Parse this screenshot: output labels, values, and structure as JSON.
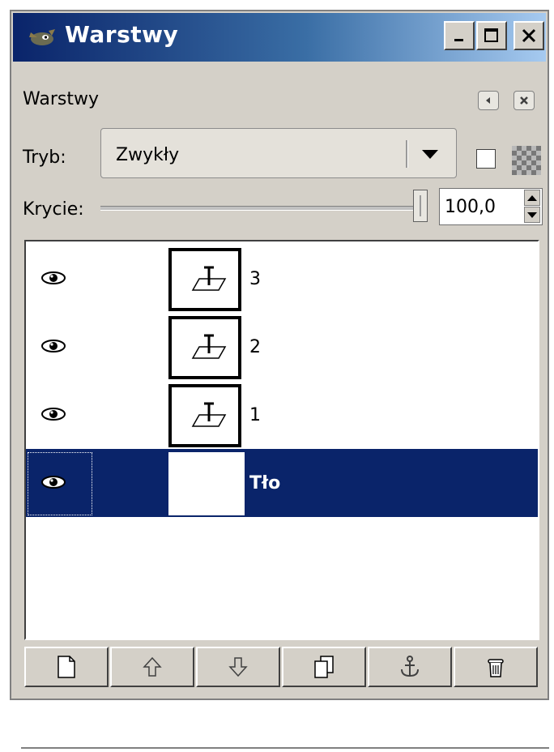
{
  "window": {
    "title": "Warstwy",
    "icon": "gimp-wilber-icon",
    "controls": {
      "minimize": "minimize-icon",
      "maximize": "maximize-icon",
      "close": "close-icon"
    }
  },
  "dock": {
    "title": "Warstwy",
    "menu_icon": "tab-menu-icon",
    "close_icon": "close-tab-icon"
  },
  "mode": {
    "label": "Tryb:",
    "value": "Zwykły"
  },
  "opacity": {
    "label": "Krycie:",
    "value": "100,0",
    "level": 1.0
  },
  "layers": [
    {
      "name": "3",
      "visible": true,
      "type": "text"
    },
    {
      "name": "2",
      "visible": true,
      "type": "text"
    },
    {
      "name": "1",
      "visible": true,
      "type": "text"
    },
    {
      "name": "Tło",
      "visible": true,
      "type": "background",
      "selected": true
    }
  ],
  "toolbar": [
    {
      "name": "new-layer-button",
      "icon": "new-layer-icon"
    },
    {
      "name": "raise-layer-button",
      "icon": "arrow-up-icon"
    },
    {
      "name": "lower-layer-button",
      "icon": "arrow-down-icon"
    },
    {
      "name": "duplicate-layer-button",
      "icon": "duplicate-icon"
    },
    {
      "name": "anchor-layer-button",
      "icon": "anchor-icon"
    },
    {
      "name": "delete-layer-button",
      "icon": "trash-icon"
    }
  ],
  "colors": {
    "titlebar_start": "#0a246a",
    "selection": "#0a246a",
    "face": "#d4d0c8"
  }
}
